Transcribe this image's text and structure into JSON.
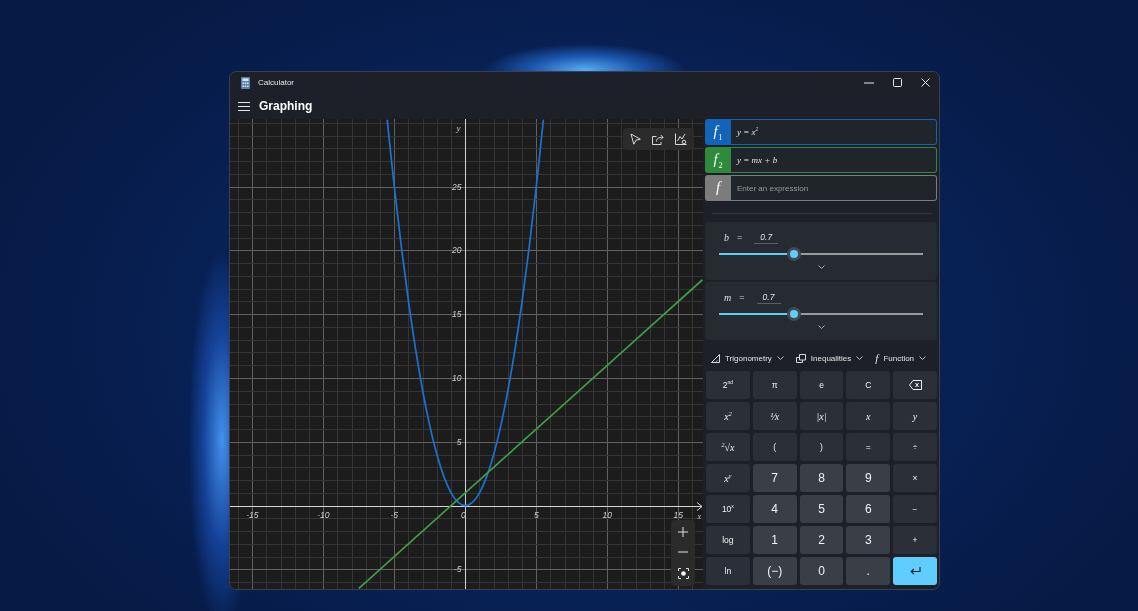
{
  "window": {
    "title": "Calculator"
  },
  "header": {
    "title": "Graphing"
  },
  "graph": {
    "chart_data": {
      "type": "line",
      "xlabel": "x",
      "ylabel": "y",
      "grid": true,
      "x": [
        -7.5,
        -6,
        -5.5,
        -5,
        -4.5,
        -4,
        -3.5,
        -3,
        -2.5,
        -2,
        -1.5,
        -1,
        -0.5,
        0,
        0.5,
        1,
        1.5,
        2,
        2.5,
        3,
        3.5,
        4,
        4.5,
        5,
        5.5,
        6,
        16.7
      ],
      "series": [
        {
          "color": "#1a72d2",
          "values": [
            null,
            null,
            30.25,
            25,
            20.25,
            16,
            12.25,
            9,
            6.25,
            4,
            2.25,
            1,
            0.25,
            0,
            0.25,
            1,
            2.25,
            4,
            6.25,
            9,
            12.25,
            16,
            20.25,
            25,
            30.25,
            null,
            null
          ]
        },
        {
          "color": "#3f9d48",
          "values": [
            -6.5,
            -5,
            -4.5,
            -4,
            -3.5,
            -3,
            -2.5,
            -2,
            -1.5,
            -1,
            -0.5,
            0,
            0.5,
            1,
            1.5,
            2,
            2.5,
            3,
            3.5,
            4,
            4.5,
            5,
            5.5,
            6,
            6.5,
            7,
            17.7
          ]
        }
      ],
      "xlim": [
        -16.57,
        16.74
      ],
      "ylim": [
        -6.54,
        30.3
      ],
      "xticks": [
        -15,
        -10,
        -5,
        0,
        5,
        10,
        15
      ],
      "yticks": [
        -5,
        5,
        10,
        15,
        20,
        25
      ]
    }
  },
  "expressions": [
    {
      "symbol": "f$_{1}$",
      "value": "y = x$^{2}$",
      "color": "#1164b8"
    },
    {
      "symbol": "f$_{2}$",
      "value": "y = mx + b",
      "color": "#2e8b3c"
    },
    {
      "symbol": "f",
      "placeholder": "Enter an expression",
      "color": "#7c7c7c"
    }
  ],
  "variables": [
    {
      "name": "b",
      "operator": "=",
      "value": "0.7",
      "level": 0.37,
      "expanded": false
    },
    {
      "name": "m",
      "operator": "=",
      "value": "0.7",
      "level": 0.37,
      "expanded": false
    }
  ],
  "toolbar": [
    {
      "kind": "trigonometry",
      "label": "Trigonometry"
    },
    {
      "kind": "inequalities",
      "label": "Inequalities"
    },
    {
      "kind": "function",
      "glyph": "f",
      "label": "Function"
    }
  ],
  "keypad": [
    {
      "label": "2$^{nd}$",
      "kind": "function"
    },
    {
      "label": "π",
      "kind": "function"
    },
    {
      "label": "e",
      "kind": "function"
    },
    {
      "label": "C",
      "kind": "function"
    },
    {
      "kind": "backspace"
    },
    {
      "label": "x$^{2}$",
      "kind": "math"
    },
    {
      "label": "¹⁄x",
      "kind": "math"
    },
    {
      "label": "|x|",
      "kind": "math"
    },
    {
      "label": "x",
      "kind": "math"
    },
    {
      "label": "y",
      "kind": "math"
    },
    {
      "label": "$^{2}$√x",
      "kind": "math"
    },
    {
      "label": "(",
      "kind": "function"
    },
    {
      "label": ")",
      "kind": "function"
    },
    {
      "label": "=",
      "kind": "function"
    },
    {
      "label": "÷",
      "kind": "function"
    },
    {
      "label": "x$^{y}$",
      "kind": "math"
    },
    {
      "label": "7",
      "kind": "number"
    },
    {
      "label": "8",
      "kind": "number"
    },
    {
      "label": "9",
      "kind": "number"
    },
    {
      "label": "×",
      "kind": "function"
    },
    {
      "label": "10$^{x}$",
      "kind": "function"
    },
    {
      "label": "4",
      "kind": "number"
    },
    {
      "label": "5",
      "kind": "number"
    },
    {
      "label": "6",
      "kind": "number"
    },
    {
      "label": "−",
      "kind": "function"
    },
    {
      "label": "log",
      "kind": "function"
    },
    {
      "label": "1",
      "kind": "number"
    },
    {
      "label": "2",
      "kind": "number"
    },
    {
      "label": "3",
      "kind": "number"
    },
    {
      "label": "+",
      "kind": "function"
    },
    {
      "label": "ln",
      "kind": "function"
    },
    {
      "label": "(−)",
      "kind": "number"
    },
    {
      "label": "0",
      "kind": "number"
    },
    {
      "label": ".",
      "kind": "number"
    },
    {
      "kind": "enter"
    }
  ]
}
